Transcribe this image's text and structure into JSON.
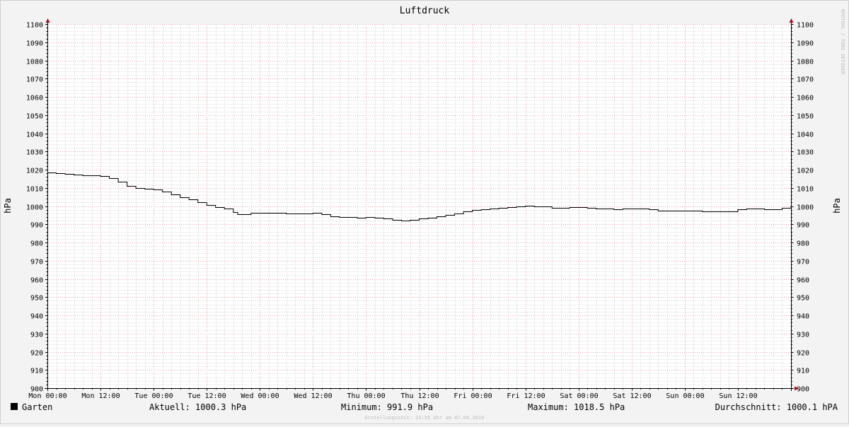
{
  "chart_data": {
    "type": "line",
    "title": "Luftdruck",
    "ylabel": "hPa",
    "ylim": [
      900,
      1100
    ],
    "yticks": [
      900,
      910,
      920,
      930,
      940,
      950,
      960,
      970,
      980,
      990,
      1000,
      1010,
      1020,
      1030,
      1040,
      1050,
      1060,
      1070,
      1080,
      1090,
      1100
    ],
    "xlim": [
      0,
      168
    ],
    "xtick_labels": [
      "Mon 00:00",
      "Mon 12:00",
      "Tue 00:00",
      "Tue 12:00",
      "Wed 00:00",
      "Wed 12:00",
      "Thu 00:00",
      "Thu 12:00",
      "Fri 00:00",
      "Fri 12:00",
      "Sat 00:00",
      "Sat 12:00",
      "Sun 00:00",
      "Sun 12:00"
    ],
    "xtick_values": [
      0,
      12,
      24,
      36,
      48,
      60,
      72,
      84,
      96,
      108,
      120,
      132,
      144,
      156
    ],
    "grid": true,
    "series": [
      {
        "name": "Garten",
        "color": "#000000",
        "x": [
          0,
          2,
          4,
          6,
          8,
          10,
          12,
          14,
          16,
          18,
          20,
          22,
          24,
          26,
          28,
          30,
          32,
          34,
          36,
          38,
          40,
          42,
          43,
          44,
          46,
          48,
          50,
          52,
          54,
          56,
          58,
          60,
          62,
          64,
          66,
          68,
          70,
          72,
          74,
          76,
          78,
          80,
          82,
          84,
          86,
          88,
          90,
          92,
          94,
          96,
          98,
          100,
          102,
          104,
          106,
          108,
          110,
          112,
          114,
          116,
          118,
          120,
          122,
          124,
          126,
          128,
          130,
          132,
          134,
          136,
          138,
          140,
          142,
          144,
          146,
          148,
          150,
          152,
          154,
          156,
          158,
          160,
          162,
          164,
          166,
          168
        ],
        "y": [
          1018.5,
          1018.2,
          1017.5,
          1017.1,
          1016.9,
          1016.8,
          1016.4,
          1015.4,
          1013.4,
          1011.2,
          1009.8,
          1009.4,
          1009.1,
          1008.0,
          1006.6,
          1005.0,
          1003.6,
          1002.3,
          1000.4,
          999.4,
          998.5,
          996.8,
          995.6,
          995.7,
          996.5,
          996.3,
          996.3,
          996.2,
          996.1,
          995.9,
          996.1,
          996.2,
          995.5,
          994.4,
          994.0,
          993.8,
          993.7,
          993.9,
          993.7,
          993.2,
          992.3,
          991.9,
          992.6,
          993.2,
          993.6,
          994.4,
          995.1,
          996.0,
          997.0,
          997.8,
          998.4,
          998.6,
          999.1,
          999.6,
          1000.0,
          1000.1,
          1000.0,
          999.9,
          999.2,
          998.9,
          999.3,
          999.5,
          998.9,
          998.6,
          998.5,
          998.3,
          998.6,
          998.6,
          998.6,
          998.3,
          997.6,
          997.5,
          997.3,
          997.6,
          997.6,
          997.2,
          997.2,
          997.1,
          997.2,
          998.2,
          998.5,
          998.5,
          998.3,
          998.4,
          999.2,
          1000.3
        ]
      }
    ]
  },
  "legend": {
    "swatch_color": "#000000",
    "series_name": "Garten",
    "aktuell": "Aktuell: 1000.3 hPa",
    "minimum": "Minimum: 991.9 hPa",
    "maximum": "Maximum: 1018.5 hPa",
    "durchschnitt": "Durchschnitt: 1000.1 hPA"
  },
  "footer": {
    "created": "Erstellungszeit: 23:55 Uhr am 07.04.2019"
  },
  "watermark": "RRDTOOL / TOBI OETIKER"
}
